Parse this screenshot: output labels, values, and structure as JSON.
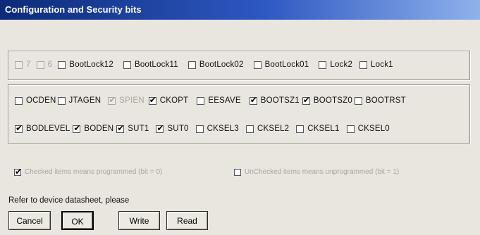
{
  "window": {
    "title": "Configuration and Security bits"
  },
  "lock_bits": [
    {
      "label": "7",
      "checked": false,
      "disabled": true
    },
    {
      "label": "6",
      "checked": false,
      "disabled": true
    },
    {
      "label": "BootLock12",
      "checked": false,
      "disabled": false
    },
    {
      "label": "BootLock11",
      "checked": false,
      "disabled": false
    },
    {
      "label": "BootLock02",
      "checked": false,
      "disabled": false
    },
    {
      "label": "BootLock01",
      "checked": false,
      "disabled": false
    },
    {
      "label": "Lock2",
      "checked": false,
      "disabled": false
    },
    {
      "label": "Lock1",
      "checked": false,
      "disabled": false
    }
  ],
  "fuse_row1": [
    {
      "label": "OCDEN",
      "checked": false,
      "disabled": false
    },
    {
      "label": "JTAGEN",
      "checked": false,
      "disabled": false
    },
    {
      "label": "SPIEN",
      "checked": true,
      "disabled": true
    },
    {
      "label": "CKOPT",
      "checked": true,
      "disabled": false
    },
    {
      "label": "EESAVE",
      "checked": false,
      "disabled": false
    },
    {
      "label": "BOOTSZ1",
      "checked": true,
      "disabled": false
    },
    {
      "label": "BOOTSZ0",
      "checked": true,
      "disabled": false
    },
    {
      "label": "BOOTRST",
      "checked": false,
      "disabled": false
    }
  ],
  "fuse_row2": [
    {
      "label": "BODLEVEL",
      "checked": true,
      "disabled": false
    },
    {
      "label": "BODEN",
      "checked": true,
      "disabled": false
    },
    {
      "label": "SUT1",
      "checked": true,
      "disabled": false
    },
    {
      "label": "SUT0",
      "checked": true,
      "disabled": false
    },
    {
      "label": "CKSEL3",
      "checked": false,
      "disabled": false
    },
    {
      "label": "CKSEL2",
      "checked": false,
      "disabled": false
    },
    {
      "label": "CKSEL1",
      "checked": false,
      "disabled": false
    },
    {
      "label": "CKSEL0",
      "checked": false,
      "disabled": false
    }
  ],
  "legend": {
    "checked_note": "Checked items means programmed (bit = 0)",
    "unchecked_note": "UnChecked items means unprogrammed (bit = 1)"
  },
  "info_text": "Refer to device datasheet, please",
  "buttons": {
    "cancel": "Cancel",
    "ok": "OK",
    "write": "Write",
    "read": "Read"
  }
}
